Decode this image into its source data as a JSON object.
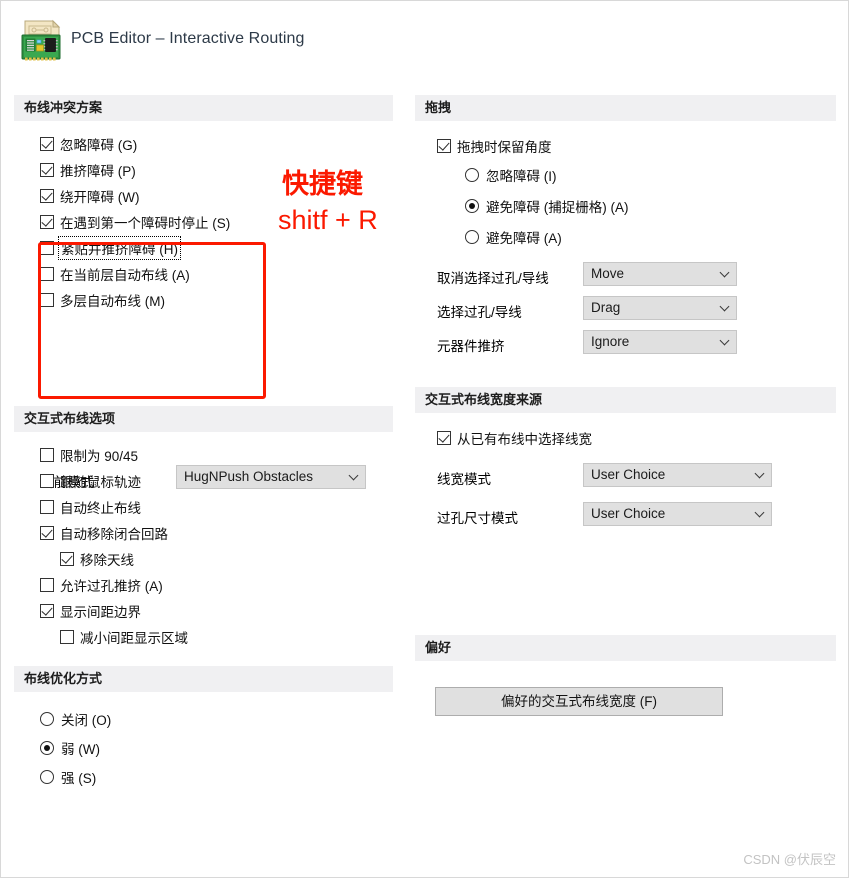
{
  "window": {
    "title": "PCB Editor – Interactive Routing",
    "icon": "pcb-board-icon"
  },
  "annotations": {
    "shortcut_label": "快捷键",
    "shortcut_keys": "shitf + R",
    "highlight_color": "#fb1900"
  },
  "watermark": "CSDN @伏辰空",
  "sections": {
    "routing_conflict": {
      "title": "布线冲突方案",
      "options": [
        {
          "label": "忽略障碍 (G)",
          "checked": true,
          "focused": false
        },
        {
          "label": "推挤障碍 (P)",
          "checked": true,
          "focused": false
        },
        {
          "label": "绕开障碍 (W)",
          "checked": true,
          "focused": false
        },
        {
          "label": "在遇到第一个障碍时停止 (S)",
          "checked": true,
          "focused": false
        },
        {
          "label": "紧贴并推挤障碍 (H)",
          "checked": false,
          "focused": true
        },
        {
          "label": "在当前层自动布线 (A)",
          "checked": false,
          "focused": false
        },
        {
          "label": "多层自动布线 (M)",
          "checked": false,
          "focused": false
        }
      ],
      "mode_label": "当前模式",
      "mode_value": "HugNPush Obstacles"
    },
    "interactive_routing_options": {
      "title": "交互式布线选项",
      "options": [
        {
          "label": "限制为 90/45",
          "checked": false,
          "indent": false
        },
        {
          "label": "跟随鼠标轨迹",
          "checked": false,
          "indent": false
        },
        {
          "label": "自动终止布线",
          "checked": false,
          "indent": false
        },
        {
          "label": "自动移除闭合回路",
          "checked": true,
          "indent": false
        },
        {
          "label": "移除天线",
          "checked": true,
          "indent": true
        },
        {
          "label": "允许过孔推挤 (A)",
          "checked": false,
          "indent": false
        },
        {
          "label": "显示间距边界",
          "checked": true,
          "indent": false
        },
        {
          "label": "减小间距显示区域",
          "checked": false,
          "indent": true
        }
      ]
    },
    "routing_optimization": {
      "title": "布线优化方式",
      "options": [
        {
          "label": "关闭 (O)",
          "selected": false
        },
        {
          "label": "弱 (W)",
          "selected": true
        },
        {
          "label": "强 (S)",
          "selected": false
        }
      ]
    },
    "drag": {
      "title": "拖拽",
      "preserve_angle": {
        "label": "拖拽时保留角度",
        "checked": true
      },
      "radios": [
        {
          "label": "忽略障碍 (I)",
          "selected": false
        },
        {
          "label": "避免障碍 (捕捉栅格) (A)",
          "selected": true
        },
        {
          "label": "避免障碍 (A)",
          "selected": false
        }
      ],
      "fields": [
        {
          "label": "取消选择过孔/导线",
          "value": "Move"
        },
        {
          "label": "选择过孔/导线",
          "value": "Drag"
        },
        {
          "label": "元器件推挤",
          "value": "Ignore"
        }
      ]
    },
    "width_source": {
      "title": "交互式布线宽度来源",
      "pick_from_existing": {
        "label": "从已有布线中选择线宽",
        "checked": true
      },
      "fields": [
        {
          "label": "线宽模式",
          "value": "User Choice"
        },
        {
          "label": "过孔尺寸模式",
          "value": "User Choice"
        }
      ]
    },
    "preferences": {
      "title": "偏好",
      "button_label": "偏好的交互式布线宽度 (F)"
    }
  }
}
